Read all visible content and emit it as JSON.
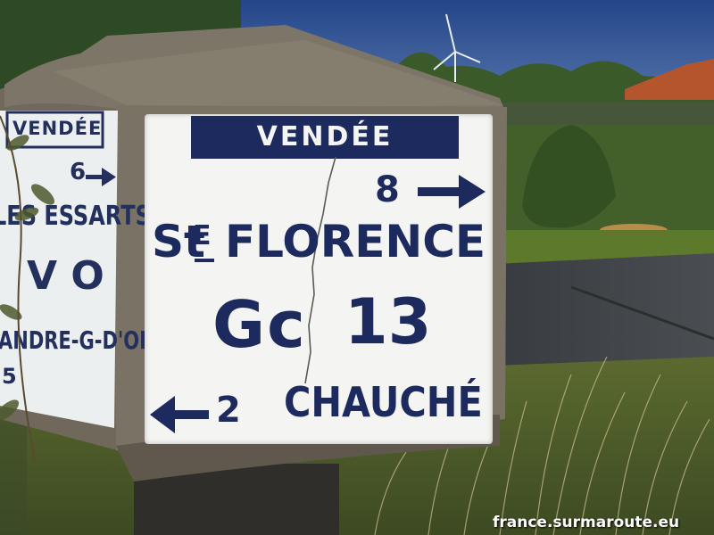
{
  "scene": {
    "colors": {
      "sky": "#2a4f93",
      "sky_horizon": "#5a79ad",
      "trees": "#2c4a22",
      "grass": "#5e6b31",
      "road": "#3f4347",
      "concrete": "#7b7466",
      "concrete_dark": "#4f4a40",
      "enamel": "#f4f4f2",
      "navy": "#1d2a5e"
    }
  },
  "sign_main": {
    "department": "VENDÉE",
    "distance_right": "8",
    "destination_right_prefix": "St",
    "destination_right_e": "E",
    "destination_right_main": "FLORENCE",
    "road_letters": "Gc",
    "road_number": "13",
    "distance_left": "2",
    "destination_left": "CHAUCHÉ"
  },
  "sign_side": {
    "department": "VENDÉE",
    "distance": "6",
    "destination": "LES ESSARTS",
    "via": "V O",
    "destination_2": "ANDRE-G-D'OIE",
    "distance_2": "5"
  },
  "watermark": "france.surmaroute.eu"
}
